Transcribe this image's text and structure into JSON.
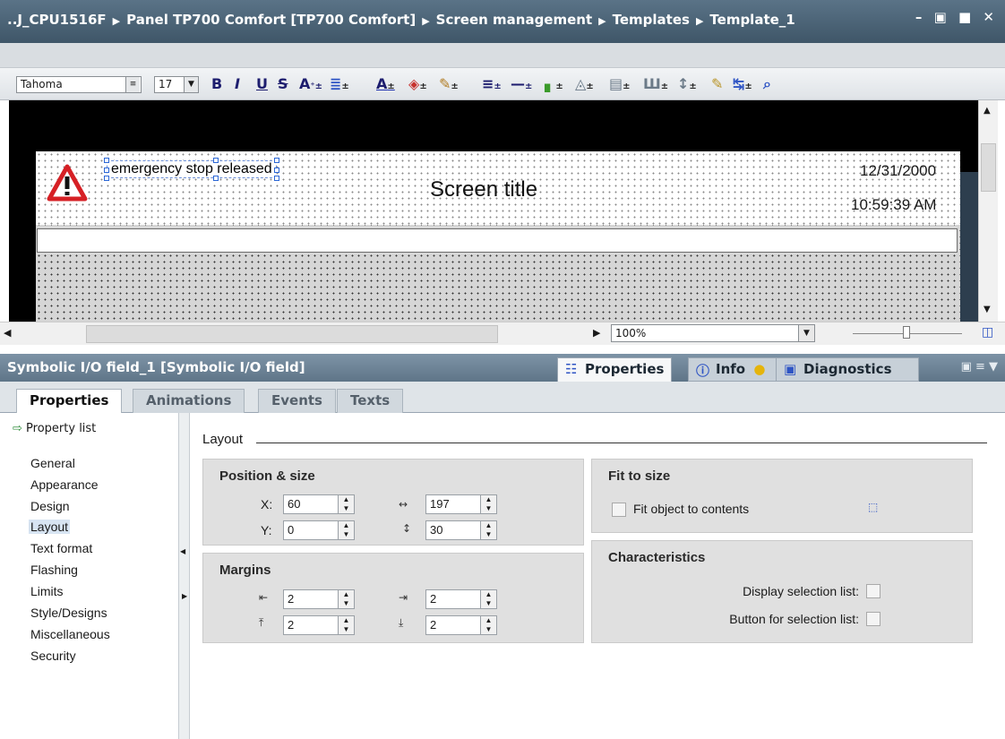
{
  "window": {
    "breadcrumb": [
      "..J_CPU1516F",
      "Panel TP700 Comfort [TP700 Comfort]",
      "Screen management",
      "Templates",
      "Template_1"
    ],
    "buttons": "– ▣ ■ ✕"
  },
  "toolbar": {
    "font": "Tahoma",
    "size": "17",
    "bold": "B",
    "italic": "I",
    "underline": "U",
    "strike": "S"
  },
  "canvas": {
    "alarm_text": "emergency stop released",
    "screen_title": "Screen title",
    "date": "12/31/2000",
    "time": "10:59:39 AM",
    "zoom": "100%"
  },
  "inspector": {
    "title": "Symbolic I/O field_1 [Symbolic I/O field]",
    "tabs": [
      "Properties",
      "Info",
      "Diagnostics"
    ],
    "subtabs": [
      "Properties",
      "Animations",
      "Events",
      "Texts"
    ],
    "nav_head": "Property list",
    "nav_items": [
      "General",
      "Appearance",
      "Design",
      "Layout",
      "Text format",
      "Flashing",
      "Limits",
      "Style/Designs",
      "Miscellaneous",
      "Security"
    ],
    "section": "Layout",
    "position_size": {
      "title": "Position & size",
      "x_label": "X:",
      "x": "60",
      "y_label": "Y:",
      "y": "0",
      "width": "197",
      "height": "30"
    },
    "margins": {
      "title": "Margins",
      "left": "2",
      "right": "2",
      "top": "2",
      "bottom": "2"
    },
    "fit_to_size": {
      "title": "Fit to size",
      "label": "Fit object to contents"
    },
    "characteristics": {
      "title": "Characteristics",
      "display_list": "Display selection list:",
      "button_list": "Button for selection list:"
    }
  }
}
